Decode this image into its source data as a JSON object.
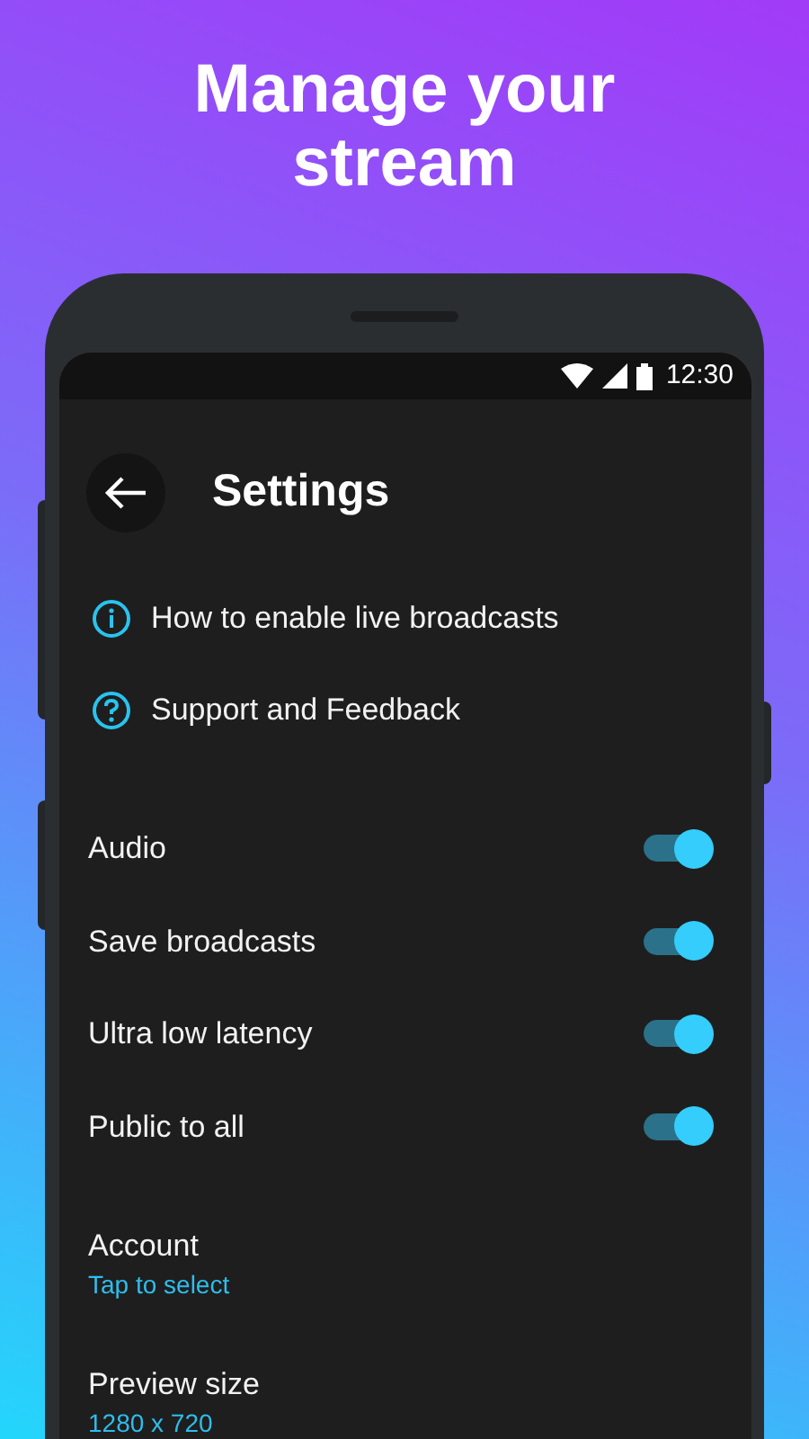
{
  "headline": "Manage your stream",
  "status_bar": {
    "time": "12:30"
  },
  "header": {
    "title": "Settings"
  },
  "links": [
    {
      "kind": "info",
      "label": "How to enable live broadcasts"
    },
    {
      "kind": "help",
      "label": "Support and Feedback"
    }
  ],
  "toggles": [
    {
      "label": "Audio",
      "on": true
    },
    {
      "label": "Save broadcasts",
      "on": true
    },
    {
      "label": "Ultra low latency",
      "on": true
    },
    {
      "label": "Public to all",
      "on": true
    }
  ],
  "options": [
    {
      "label": "Account",
      "value": "Tap to select"
    },
    {
      "label": "Preview size",
      "value": "1280 x 720"
    }
  ]
}
